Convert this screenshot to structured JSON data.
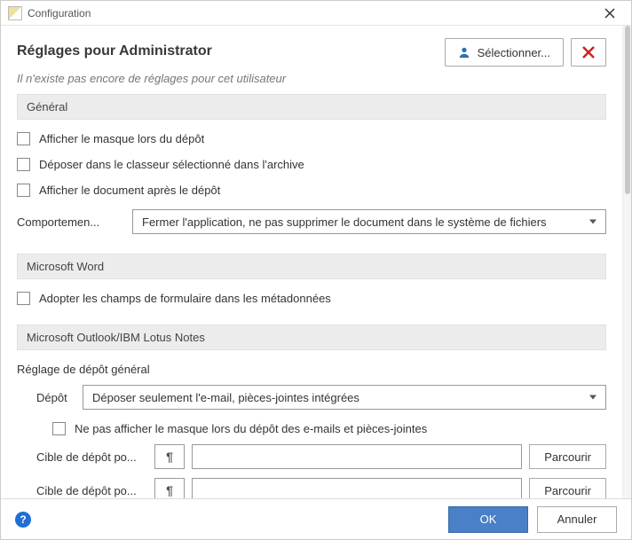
{
  "titlebar": {
    "title": "Configuration"
  },
  "header": {
    "title": "Réglages pour  Administrator",
    "select_user_label": "Sélectionner...",
    "notice": "Il n'existe pas encore de réglages pour cet utilisateur"
  },
  "sections": {
    "general": {
      "title": "Général",
      "chk_show_mask": "Afficher le masque lors du dépôt",
      "chk_deposit_in_selected": "Déposer dans le classeur sélectionné dans l'archive",
      "chk_show_doc_after": "Afficher le document après le dépôt",
      "behavior_label": "Comportemen...",
      "behavior_value": "Fermer l'application, ne pas supprimer le document dans le système de fichiers"
    },
    "word": {
      "title": "Microsoft Word",
      "chk_adopt_fields": "Adopter les champs de formulaire dans les métadonnées"
    },
    "outlook": {
      "title": "Microsoft Outlook/IBM Lotus Notes",
      "general_setting": "Réglage de dépôt général",
      "deposit_label": "Dépôt",
      "deposit_value": "Déposer seulement l'e-mail, pièces-jointes intégrées",
      "chk_no_mask_email": "Ne pas afficher le masque lors du dépôt des e-mails et pièces-jointes",
      "target_label": "Cible de dépôt po...",
      "pilcrow": "¶",
      "browse": "Parcourir"
    }
  },
  "footer": {
    "ok": "OK",
    "cancel": "Annuler"
  }
}
